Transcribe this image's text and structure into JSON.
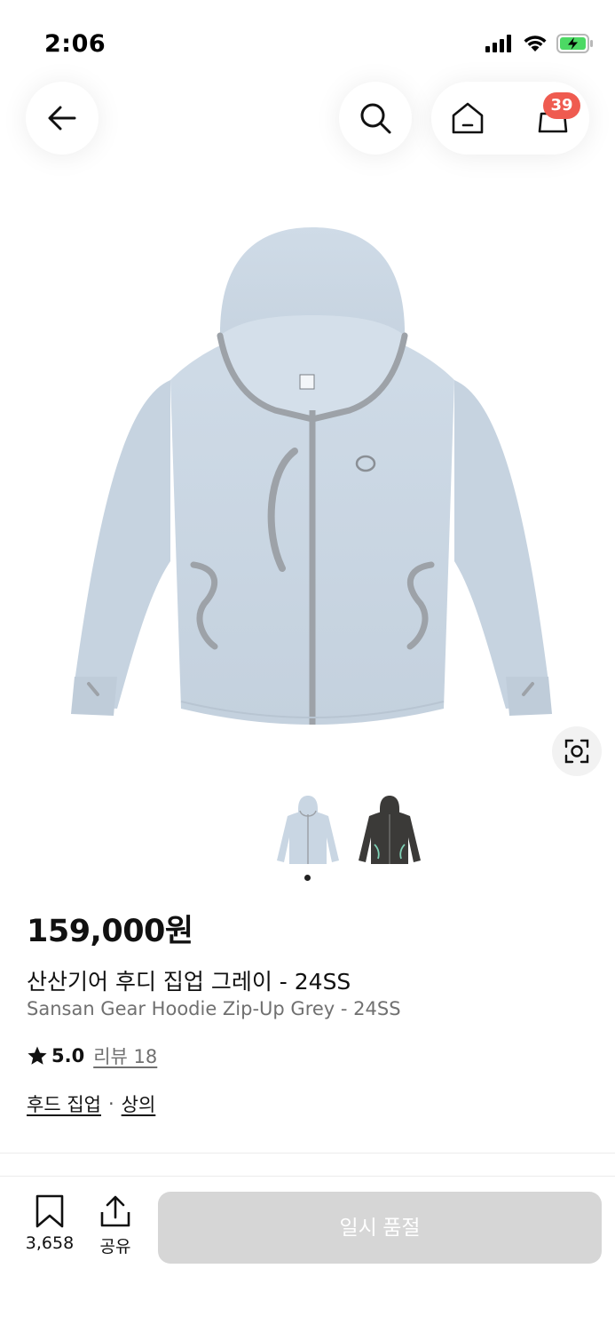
{
  "status_bar": {
    "time": "2:06",
    "icons": [
      "cellular-signal-icon",
      "wifi-icon",
      "battery-charging-icon"
    ],
    "battery_color": "#4cd964"
  },
  "top_nav": {
    "icons": [
      "back-arrow-icon",
      "search-icon",
      "home-icon",
      "cart-icon"
    ],
    "cart_count": "39",
    "badge_color": "#ef5b50"
  },
  "gallery": {
    "main_image": "light-blue zip-up hoodie",
    "thumbnails": [
      "grey hoodie",
      "charcoal hoodie"
    ],
    "active_index": 0,
    "image_search_icon": "image-search-icon",
    "hoodie_color": "#c9d6e3",
    "trim_color": "#9da2a8"
  },
  "product": {
    "price": "159,000원",
    "name_ko": "산산기어 후디 집업 그레이 - 24SS",
    "name_en": "Sansan Gear Hoodie Zip-Up Grey - 24SS",
    "rating": "5.0",
    "review_label": "리뷰 18",
    "categories": [
      "후드 집업",
      "상의"
    ],
    "category_separator": "·"
  },
  "bottom_bar": {
    "bookmark_count": "3,658",
    "share_label": "공유",
    "soldout_label": "일시 품절",
    "soldout_color": "#d6d6d6"
  }
}
